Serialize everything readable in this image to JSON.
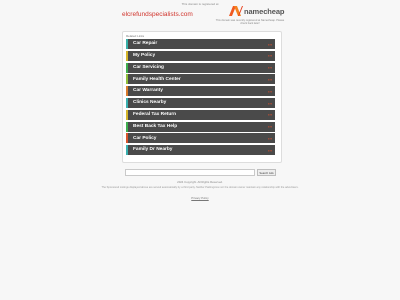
{
  "header": {
    "top_note": "This domain is registered at",
    "domain": "elcrefundspecialists.com",
    "brand": "namecheap",
    "brand_tagline": "This domain was recently registered at Namecheap. Please check back later!"
  },
  "panel": {
    "label": "Related Links",
    "arrow_glyph": "›››",
    "links": [
      {
        "label": "Car Repair",
        "bar_color": "#37b0a8"
      },
      {
        "label": "My Policy",
        "bar_color": "#d4b52a"
      },
      {
        "label": "Car Servicing",
        "bar_color": "#3fae4f"
      },
      {
        "label": "Family Health Center",
        "bar_color": "#8fbf3a"
      },
      {
        "label": "Car Warranty",
        "bar_color": "#d97a2b"
      },
      {
        "label": "Clinics Nearby",
        "bar_color": "#3ab0b0"
      },
      {
        "label": "Federal Tax Return",
        "bar_color": "#d4b52a"
      },
      {
        "label": "Best Back Tax Help",
        "bar_color": "#3fae4f"
      },
      {
        "label": "Car Policy",
        "bar_color": "#d9542c"
      },
      {
        "label": "Family Dr Nearby",
        "bar_color": "#3ab0b0"
      }
    ]
  },
  "search": {
    "placeholder": "",
    "button_label": "Search Ads"
  },
  "footer": {
    "copyright": "2024 Copyright. All Rights Reserved.",
    "disclaimer": "The Sponsored Listings displayed above are served automatically by a third party. Neither Parkingcrew nor the domain owner maintain any relationship with the advertisers.",
    "privacy": "Privacy Policy"
  },
  "colors": {
    "accent": "#e9512c",
    "domain_link": "#d0342c",
    "link_bg": "#4a4a4a"
  }
}
